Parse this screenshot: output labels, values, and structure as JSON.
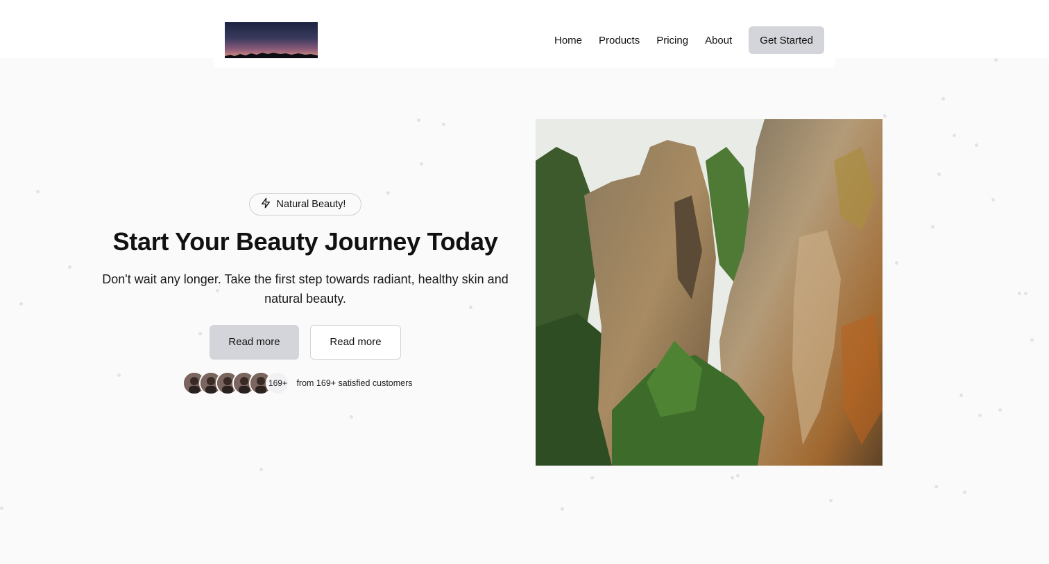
{
  "header": {
    "logo_alt": "logo",
    "nav": [
      {
        "label": "Home"
      },
      {
        "label": "Products"
      },
      {
        "label": "Pricing"
      },
      {
        "label": "About"
      }
    ],
    "cta_label": "Get Started"
  },
  "hero": {
    "badge": {
      "icon": "lightning-icon",
      "label": "Natural Beauty!"
    },
    "title": "Start Your Beauty Journey Today",
    "subtitle": "Don't wait any longer. Take the first step towards radiant, healthy skin and natural beauty.",
    "primary_button": "Read more",
    "secondary_button": "Read more",
    "social_proof": {
      "avatar_count": 5,
      "count_badge": "169+",
      "text": "from 169+ satisfied customers"
    },
    "image": {
      "subject": "sandstone-rock-towers-forest"
    }
  },
  "colors": {
    "background": "#fafafa",
    "button_fill": "#d4d5da",
    "text": "#111111"
  }
}
